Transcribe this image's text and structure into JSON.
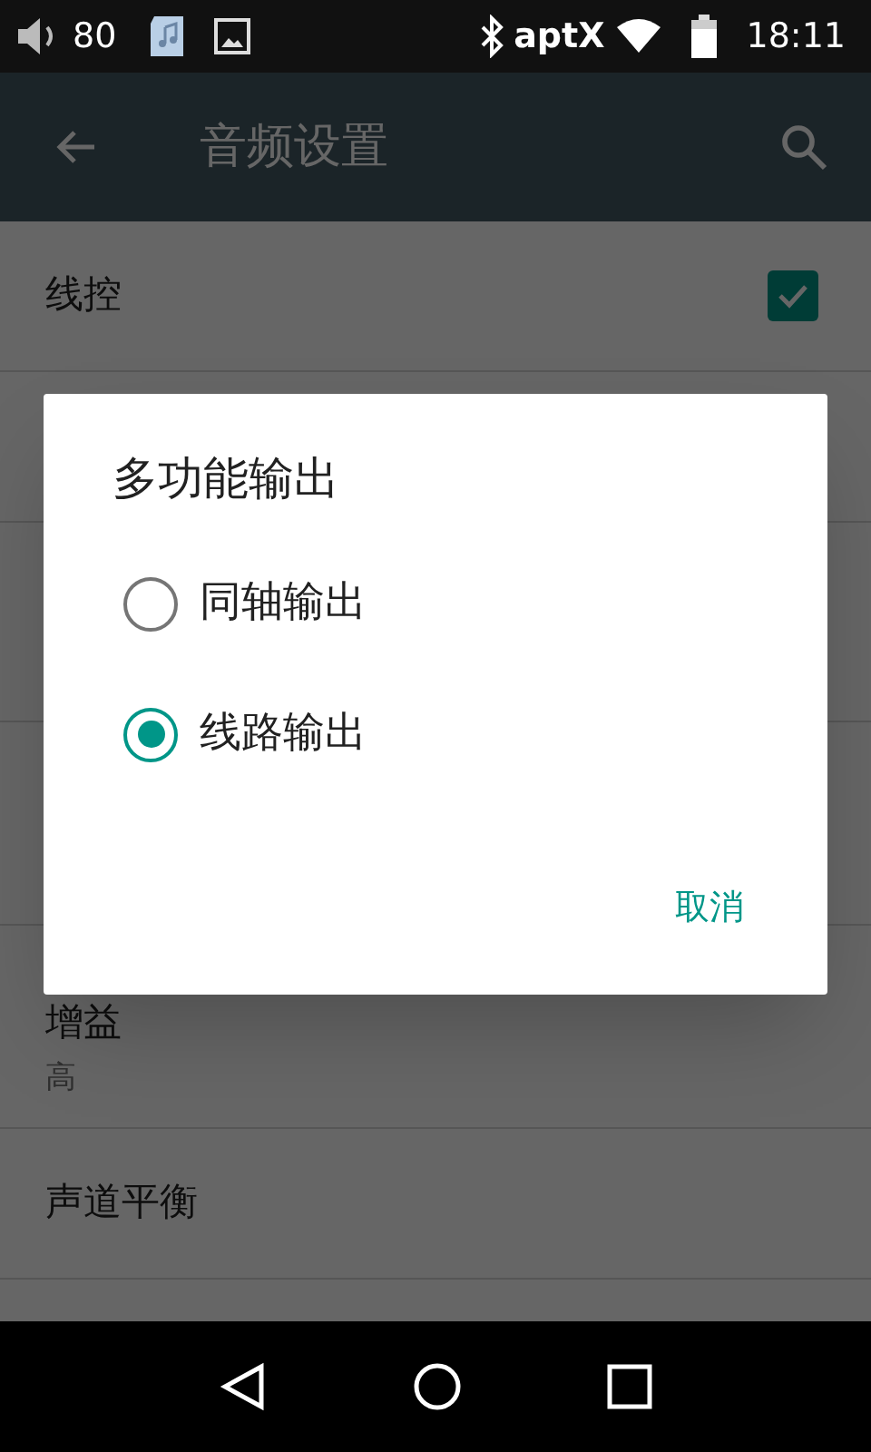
{
  "status_bar": {
    "volume": "80",
    "codec": "aptX",
    "time": "18:11"
  },
  "app_bar": {
    "title": "音频设置"
  },
  "settings": [
    {
      "title": "线控",
      "kind": "checkbox",
      "checked": true
    },
    {
      "title": "增益",
      "summary": "高",
      "kind": "text"
    },
    {
      "title": "声道平衡",
      "kind": "text"
    }
  ],
  "dialog": {
    "title": "多功能输出",
    "options": [
      {
        "label": "同轴输出",
        "selected": false
      },
      {
        "label": "线路输出",
        "selected": true
      }
    ],
    "buttons": [
      "取消"
    ]
  }
}
